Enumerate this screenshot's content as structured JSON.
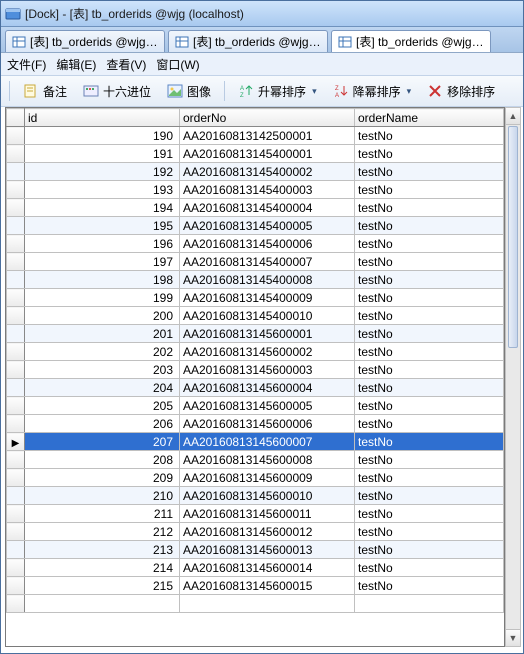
{
  "window": {
    "title": "[Dock] - [表] tb_orderids @wjg (localhost)"
  },
  "tabs": [
    {
      "label": "[表] tb_orderids @wjg (lo...",
      "active": false
    },
    {
      "label": "[表] tb_orderids @wjg (lo...",
      "active": false
    },
    {
      "label": "[表] tb_orderids @wjg (lo...",
      "active": true
    }
  ],
  "menu": {
    "file": "文件(F)",
    "edit": "编辑(E)",
    "view": "查看(V)",
    "window": "窗口(W)"
  },
  "toolbar": {
    "note": "备注",
    "hex": "十六进位",
    "image": "图像",
    "sort_asc": "升幂排序",
    "sort_desc": "降幂排序",
    "remove_sort": "移除排序"
  },
  "grid": {
    "columns": {
      "id": "id",
      "orderNo": "orderNo",
      "orderName": "orderName"
    },
    "selected_index": 17,
    "rows": [
      {
        "id": 190,
        "orderNo": "AA20160813142500001",
        "orderName": "testNo"
      },
      {
        "id": 191,
        "orderNo": "AA20160813145400001",
        "orderName": "testNo"
      },
      {
        "id": 192,
        "orderNo": "AA20160813145400002",
        "orderName": "testNo"
      },
      {
        "id": 193,
        "orderNo": "AA20160813145400003",
        "orderName": "testNo"
      },
      {
        "id": 194,
        "orderNo": "AA20160813145400004",
        "orderName": "testNo"
      },
      {
        "id": 195,
        "orderNo": "AA20160813145400005",
        "orderName": "testNo"
      },
      {
        "id": 196,
        "orderNo": "AA20160813145400006",
        "orderName": "testNo"
      },
      {
        "id": 197,
        "orderNo": "AA20160813145400007",
        "orderName": "testNo"
      },
      {
        "id": 198,
        "orderNo": "AA20160813145400008",
        "orderName": "testNo"
      },
      {
        "id": 199,
        "orderNo": "AA20160813145400009",
        "orderName": "testNo"
      },
      {
        "id": 200,
        "orderNo": "AA20160813145400010",
        "orderName": "testNo"
      },
      {
        "id": 201,
        "orderNo": "AA20160813145600001",
        "orderName": "testNo"
      },
      {
        "id": 202,
        "orderNo": "AA20160813145600002",
        "orderName": "testNo"
      },
      {
        "id": 203,
        "orderNo": "AA20160813145600003",
        "orderName": "testNo"
      },
      {
        "id": 204,
        "orderNo": "AA20160813145600004",
        "orderName": "testNo"
      },
      {
        "id": 205,
        "orderNo": "AA20160813145600005",
        "orderName": "testNo"
      },
      {
        "id": 206,
        "orderNo": "AA20160813145600006",
        "orderName": "testNo"
      },
      {
        "id": 207,
        "orderNo": "AA20160813145600007",
        "orderName": "testNo"
      },
      {
        "id": 208,
        "orderNo": "AA20160813145600008",
        "orderName": "testNo"
      },
      {
        "id": 209,
        "orderNo": "AA20160813145600009",
        "orderName": "testNo"
      },
      {
        "id": 210,
        "orderNo": "AA20160813145600010",
        "orderName": "testNo"
      },
      {
        "id": 211,
        "orderNo": "AA20160813145600011",
        "orderName": "testNo"
      },
      {
        "id": 212,
        "orderNo": "AA20160813145600012",
        "orderName": "testNo"
      },
      {
        "id": 213,
        "orderNo": "AA20160813145600013",
        "orderName": "testNo"
      },
      {
        "id": 214,
        "orderNo": "AA20160813145600014",
        "orderName": "testNo"
      },
      {
        "id": 215,
        "orderNo": "AA20160813145600015",
        "orderName": "testNo"
      }
    ]
  }
}
